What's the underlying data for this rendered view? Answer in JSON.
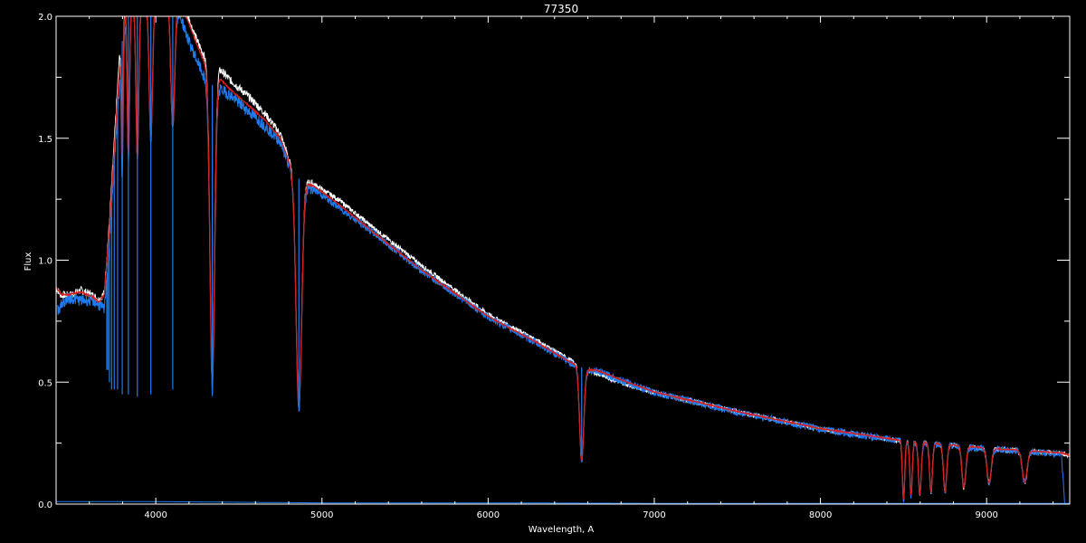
{
  "chart_data": {
    "type": "line",
    "title": "77350",
    "xlabel": "Wavelength, A",
    "ylabel": "Flux",
    "xlim": [
      3400,
      9500
    ],
    "ylim": [
      0.0,
      2.0
    ],
    "grid": false,
    "x_ticks": [
      {
        "value": 4000,
        "label": "4000"
      },
      {
        "value": 5000,
        "label": "5000"
      },
      {
        "value": 6000,
        "label": "6000"
      },
      {
        "value": 7000,
        "label": "7000"
      },
      {
        "value": 8000,
        "label": "8000"
      },
      {
        "value": 9000,
        "label": "9000"
      }
    ],
    "y_ticks": [
      {
        "value": 0.0,
        "label": "0.0"
      },
      {
        "value": 0.5,
        "label": "0.5"
      },
      {
        "value": 1.0,
        "label": "1.0"
      },
      {
        "value": 1.5,
        "label": "1.5"
      },
      {
        "value": 2.0,
        "label": "2.0"
      }
    ],
    "series": [
      {
        "color": "#ffffff",
        "x": [
          3400,
          3430,
          3480,
          3550,
          3620,
          3660,
          3690,
          3720,
          3760,
          3800,
          3850,
          3900,
          3950,
          4000,
          4100,
          4150,
          4200,
          4250,
          4300,
          4330,
          4380,
          4450,
          4550,
          4650,
          4750,
          4820,
          4900,
          4960,
          5100,
          5300,
          5600,
          6000,
          6300,
          6500,
          6600,
          6650,
          6800,
          7000,
          7500,
          8000,
          8500,
          9000,
          9450,
          9500
        ],
        "y": [
          0.89,
          0.86,
          0.86,
          0.88,
          0.86,
          0.84,
          0.87,
          1.15,
          1.6,
          2.05,
          2.05,
          2.05,
          2.05,
          2.05,
          2.05,
          2.05,
          1.99,
          1.9,
          1.83,
          1.79,
          1.79,
          1.74,
          1.68,
          1.61,
          1.52,
          1.38,
          1.33,
          1.31,
          1.25,
          1.14,
          0.98,
          0.78,
          0.67,
          0.59,
          0.55,
          0.54,
          0.5,
          0.46,
          0.38,
          0.31,
          0.26,
          0.23,
          0.21,
          0.2
        ]
      },
      {
        "color": "#1e7cf0",
        "x": [
          3410,
          3440,
          3480,
          3550,
          3620,
          3660,
          3690,
          3720,
          3760,
          3800,
          3850,
          3900,
          3950,
          4000,
          4100,
          4150,
          4200,
          4250,
          4300,
          4330,
          4380,
          4450,
          4550,
          4650,
          4750,
          4820,
          4900,
          4960,
          5100,
          5300,
          5600,
          6000,
          6300,
          6500,
          6600,
          6650,
          6800,
          7000,
          7500,
          8000,
          8500,
          9000,
          9450,
          9470
        ],
        "y": [
          0.8,
          0.83,
          0.85,
          0.84,
          0.84,
          0.82,
          0.8,
          1.06,
          1.5,
          1.92,
          2.05,
          2.05,
          2.05,
          2.05,
          2.05,
          2.0,
          1.9,
          1.82,
          1.74,
          1.72,
          1.71,
          1.68,
          1.62,
          1.56,
          1.49,
          1.36,
          1.31,
          1.29,
          1.22,
          1.12,
          0.96,
          0.77,
          0.66,
          0.58,
          0.55,
          0.55,
          0.51,
          0.46,
          0.38,
          0.31,
          0.26,
          0.23,
          0.21,
          0.0
        ]
      },
      {
        "color": "#d42020",
        "x": [
          3400,
          3430,
          3480,
          3550,
          3620,
          3660,
          3690,
          3720,
          3760,
          3800,
          3850,
          3900,
          3950,
          4000,
          4100,
          4150,
          4200,
          4250,
          4300,
          4330,
          4380,
          4450,
          4550,
          4650,
          4750,
          4820,
          4900,
          4960,
          5100,
          5300,
          5600,
          6000,
          6300,
          6500,
          6600,
          6650,
          6800,
          7000,
          7500,
          8000,
          8500,
          9000,
          9450,
          9500
        ],
        "y": [
          0.89,
          0.86,
          0.86,
          0.87,
          0.85,
          0.83,
          0.86,
          1.12,
          1.56,
          2.0,
          2.05,
          2.05,
          2.05,
          2.05,
          2.05,
          2.05,
          1.97,
          1.88,
          1.8,
          1.76,
          1.75,
          1.7,
          1.64,
          1.58,
          1.5,
          1.37,
          1.32,
          1.3,
          1.23,
          1.12,
          0.96,
          0.77,
          0.66,
          0.58,
          0.55,
          0.55,
          0.51,
          0.46,
          0.38,
          0.31,
          0.26,
          0.23,
          0.21,
          0.2
        ]
      },
      {
        "color": "#1e7cf0",
        "x": [
          3400,
          4000,
          5000,
          6000,
          7000,
          8000,
          9000,
          9500
        ],
        "y": [
          0.01,
          0.01,
          0.005,
          0.005,
          0.003,
          0.003,
          0.003,
          0.003
        ]
      }
    ],
    "absorption_lines": [
      {
        "x": 3705,
        "depth": 0.55,
        "color": "#1e7cf0"
      },
      {
        "x": 3712,
        "depth": 0.55,
        "color": "#1e7cf0"
      },
      {
        "x": 3721,
        "depth": 0.5,
        "color": "#1e7cf0"
      },
      {
        "x": 3734,
        "depth": 0.47,
        "color": "#1e7cf0"
      },
      {
        "x": 3750,
        "depth": 0.47,
        "color": "#1e7cf0"
      },
      {
        "x": 3770,
        "depth": 0.47,
        "color": "#1e7cf0"
      },
      {
        "x": 3798,
        "depth": 0.45,
        "color": "#1e7cf0"
      },
      {
        "x": 3835,
        "depth": 0.45,
        "color": "#1e7cf0"
      },
      {
        "x": 3889,
        "depth": 0.44,
        "color": "#1e7cf0"
      },
      {
        "x": 3970,
        "depth": 0.45,
        "color": "#1e7cf0"
      },
      {
        "x": 4102,
        "depth": 0.47,
        "color": "#1e7cf0"
      },
      {
        "x": 4340,
        "depth": 0.45,
        "color": "#1e7cf0"
      },
      {
        "x": 4861,
        "depth": 0.38,
        "color": "#1e7cf0"
      },
      {
        "x": 6563,
        "depth": 0.2,
        "color": "#1e7cf0"
      }
    ],
    "broad_dips": [
      {
        "x": 3798,
        "depth": 0.55,
        "width": 8
      },
      {
        "x": 3835,
        "depth": 0.6,
        "width": 10
      },
      {
        "x": 3889,
        "depth": 0.62,
        "width": 12
      },
      {
        "x": 3970,
        "depth": 0.55,
        "width": 14
      },
      {
        "x": 4102,
        "depth": 0.5,
        "width": 16
      },
      {
        "x": 4340,
        "depth": 1.25,
        "width": 20
      },
      {
        "x": 4861,
        "depth": 0.94,
        "width": 24
      },
      {
        "x": 6563,
        "depth": 0.38,
        "width": 18
      },
      {
        "x": 8500,
        "depth": 0.24,
        "width": 10
      },
      {
        "x": 8545,
        "depth": 0.22,
        "width": 10
      },
      {
        "x": 8598,
        "depth": 0.21,
        "width": 12
      },
      {
        "x": 8665,
        "depth": 0.2,
        "width": 12
      },
      {
        "x": 8750,
        "depth": 0.19,
        "width": 14
      },
      {
        "x": 8863,
        "depth": 0.17,
        "width": 16
      },
      {
        "x": 9015,
        "depth": 0.14,
        "width": 18
      },
      {
        "x": 9229,
        "depth": 0.13,
        "width": 20
      }
    ]
  }
}
